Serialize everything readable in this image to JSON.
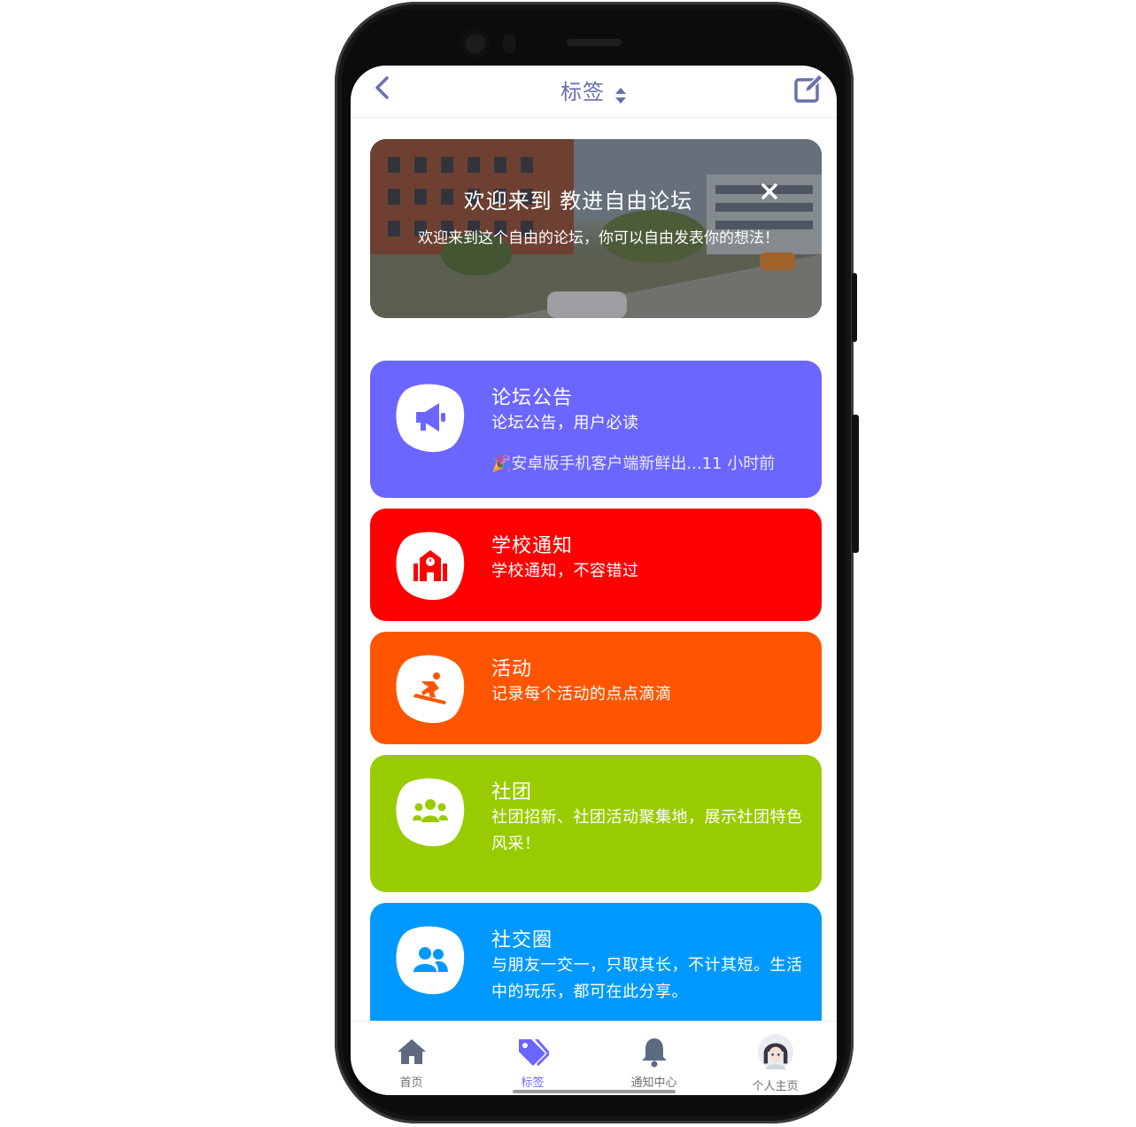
{
  "header": {
    "title": "标签"
  },
  "banner": {
    "title": "欢迎来到 教进自由论坛",
    "text": "欢迎来到这个自由的论坛，你可以自由发表你的想法！"
  },
  "categories": [
    {
      "name": "论坛公告",
      "desc": "论坛公告，用户必读",
      "latest": "🎉安卓版手机客户端新鲜出...11 小时前",
      "color": "#6b66ff",
      "icon": "megaphone-icon"
    },
    {
      "name": "学校通知",
      "desc": "学校通知，不容错过",
      "color": "#ff0000",
      "icon": "school-icon"
    },
    {
      "name": "活动",
      "desc": "记录每个活动的点点滴滴",
      "color": "#ff5500",
      "icon": "snowboarding-icon"
    },
    {
      "name": "社团",
      "desc": "社团招新、社团活动聚集地，展示社团特色风采！",
      "color": "#99cc00",
      "icon": "users-icon"
    },
    {
      "name": "社交圈",
      "desc": "与朋友一交一，只取其长，不计其短。生活中的玩乐，都可在此分享。",
      "color": "#0099ff",
      "icon": "user-friends-icon"
    }
  ],
  "tabbar": {
    "items": [
      {
        "label": "首页",
        "icon": "home-icon"
      },
      {
        "label": "标签",
        "icon": "tags-icon",
        "active": true
      },
      {
        "label": "通知中心",
        "icon": "bell-icon"
      },
      {
        "label": "个人主页",
        "icon": "avatar"
      }
    ],
    "active_color": "#6b66ff"
  }
}
